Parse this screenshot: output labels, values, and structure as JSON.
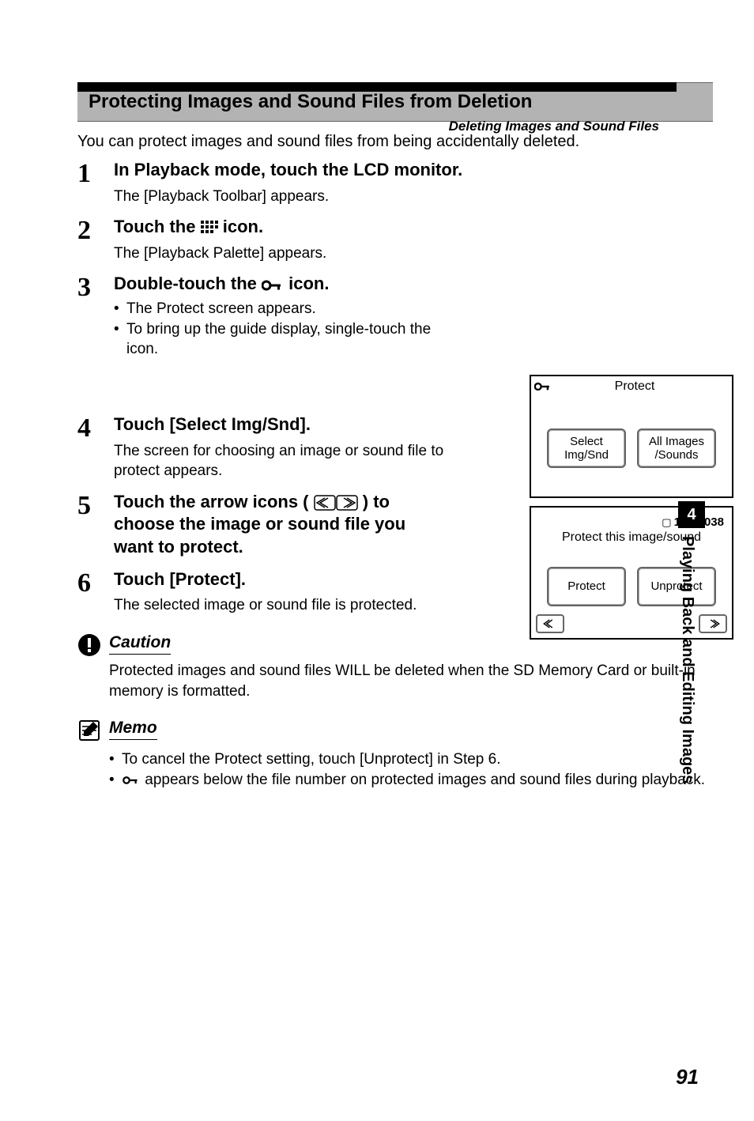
{
  "header": {
    "breadcrumb": "Deleting Images and Sound Files"
  },
  "section": {
    "title": "Protecting Images and Sound Files from Deletion",
    "intro": "You can protect images and sound files from being accidentally deleted."
  },
  "steps": {
    "s1": {
      "num": "1",
      "head": "In Playback mode, touch the LCD monitor.",
      "desc": "The [Playback Toolbar] appears."
    },
    "s2": {
      "num": "2",
      "head_before": "Touch the ",
      "head_after": " icon.",
      "desc": "The [Playback Palette] appears."
    },
    "s3": {
      "num": "3",
      "head_before": "Double-touch the ",
      "head_after": " icon.",
      "b1": "The Protect screen appears.",
      "b2": "To bring up the guide display, single-touch the icon."
    },
    "s4": {
      "num": "4",
      "head": "Touch [Select Img/Snd].",
      "desc": "The screen for choosing an image or sound file to protect appears."
    },
    "s5": {
      "num": "5",
      "head_before": "Touch the arrow icons (",
      "head_after": ") to choose the image or sound file you want to protect."
    },
    "s6": {
      "num": "6",
      "head": "Touch [Protect].",
      "desc": "The selected image or sound file is protected."
    }
  },
  "screen1": {
    "title": "Protect",
    "btn1a": "Select",
    "btn1b": "Img/Snd",
    "btn2a": "All Images",
    "btn2b": "/Sounds"
  },
  "screen2": {
    "file_num": "100-0038",
    "prompt": "Protect this image/sound",
    "btn1": "Protect",
    "btn2": "Unprotect"
  },
  "caution": {
    "title": "Caution",
    "body": "Protected images and sound files WILL be deleted when the SD Memory Card or built-in memory is formatted."
  },
  "memo": {
    "title": "Memo",
    "b1": "To cancel the Protect setting, touch [Unprotect] in Step 6.",
    "b2_after": " appears below the file number on protected images and sound files during playback."
  },
  "sidebar": {
    "chapter_num": "4",
    "chapter_title": "Playing Back and Editing Images"
  },
  "page_number": "91"
}
